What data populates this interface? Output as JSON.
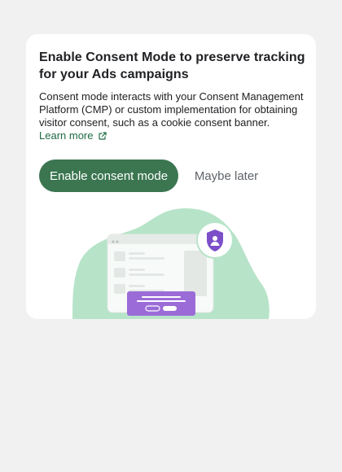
{
  "dialog": {
    "title": "Enable Consent Mode to preserve tracking for your Ads campaigns",
    "description": "Consent mode interacts with your Consent Management Platform (CMP) or custom implementation for obtaining visitor consent, such as a cookie consent banner.",
    "learn_more_label": "Learn more",
    "primary_button_label": "Enable consent mode",
    "secondary_button_label": "Maybe later"
  },
  "icons": {
    "learn_more": "external-link-icon",
    "illustration_badge": "shield-user-icon"
  },
  "colors": {
    "primary": "#3b7651",
    "link": "#1e6b44",
    "illustration_blob": "#b7e4c9",
    "banner": "#9b6cd8"
  }
}
